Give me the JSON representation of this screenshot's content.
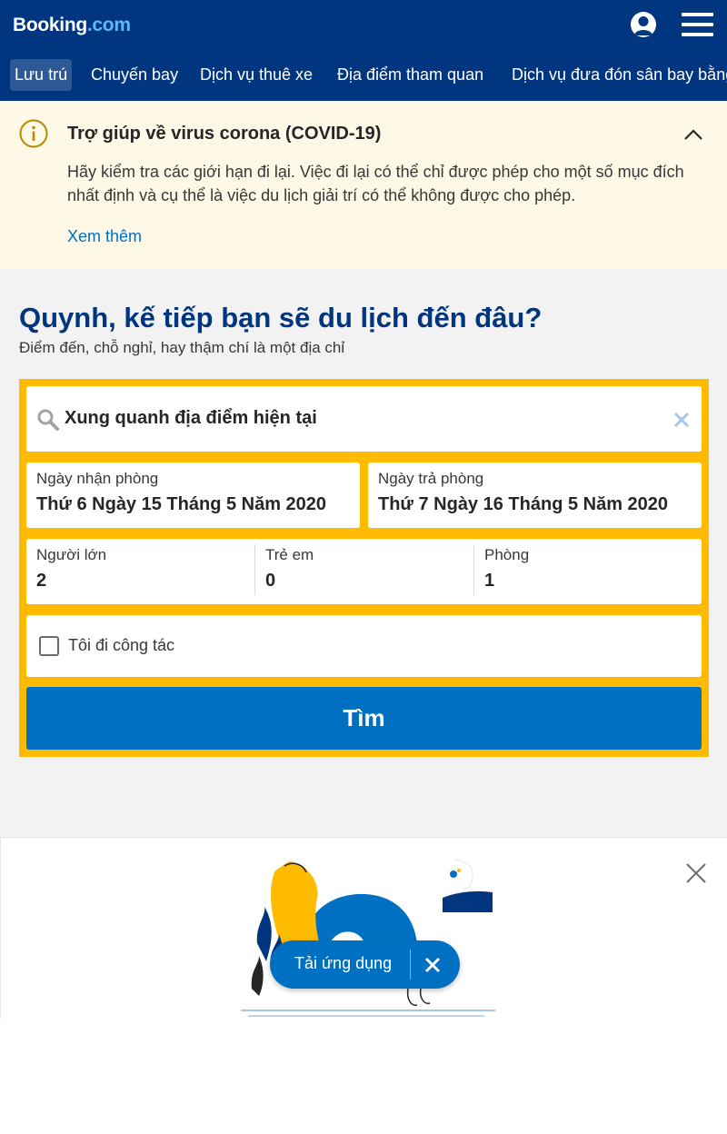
{
  "header": {
    "logo_main": "Booking",
    "logo_suffix": ".com",
    "icons": {
      "user": "user-account-icon",
      "menu": "hamburger-menu-icon"
    },
    "colors": {
      "primary": "#003580",
      "accent_link": "#0071c2",
      "search_frame": "#febb02"
    }
  },
  "nav": {
    "items": [
      {
        "label": "Lưu trú",
        "active": true
      },
      {
        "label": "Chuyến bay",
        "active": false
      },
      {
        "label": "Dịch vụ thuê xe",
        "active": false
      },
      {
        "label": "Địa điểm tham quan",
        "active": false
      },
      {
        "label": "Dịch vụ đưa đón sân bay bằng taxi",
        "active": false
      }
    ]
  },
  "covid": {
    "icon": "info-icon",
    "title": "Trợ giúp về virus corona (COVID-19)",
    "text": "Hãy kiểm tra các giới hạn đi lại. Việc đi lại có thể chỉ được phép cho một số mục đích nhất định và cụ thể là việc du lịch giải trí có thể không được cho phép.",
    "link": "Xem thêm",
    "collapse_icon": "chevron-up-icon"
  },
  "search": {
    "headline": "Quynh, kế tiếp bạn sẽ du lịch đến đâu?",
    "subline": "Điểm đến, chỗ nghỉ, hay thậm chí là một địa chỉ",
    "destination_value": "Xung quanh địa điểm hiện tại",
    "checkin": {
      "label": "Ngày nhận phòng",
      "value": "Thứ 6 Ngày 15 Tháng 5 Năm 2020"
    },
    "checkout": {
      "label": "Ngày trả phòng",
      "value": "Thứ 7 Ngày 16 Tháng 5 Năm 2020"
    },
    "adults": {
      "label": "Người lớn",
      "value": "2"
    },
    "children": {
      "label": "Trẻ em",
      "value": "0"
    },
    "rooms": {
      "label": "Phòng",
      "value": "1"
    },
    "business_label": "Tôi đi công tác",
    "business_checked": false,
    "submit_label": "Tìm"
  },
  "app_banner": {
    "cta_label": "Tải ứng dụng",
    "icons": {
      "close": "close-icon",
      "pill_close": "close-icon"
    }
  }
}
